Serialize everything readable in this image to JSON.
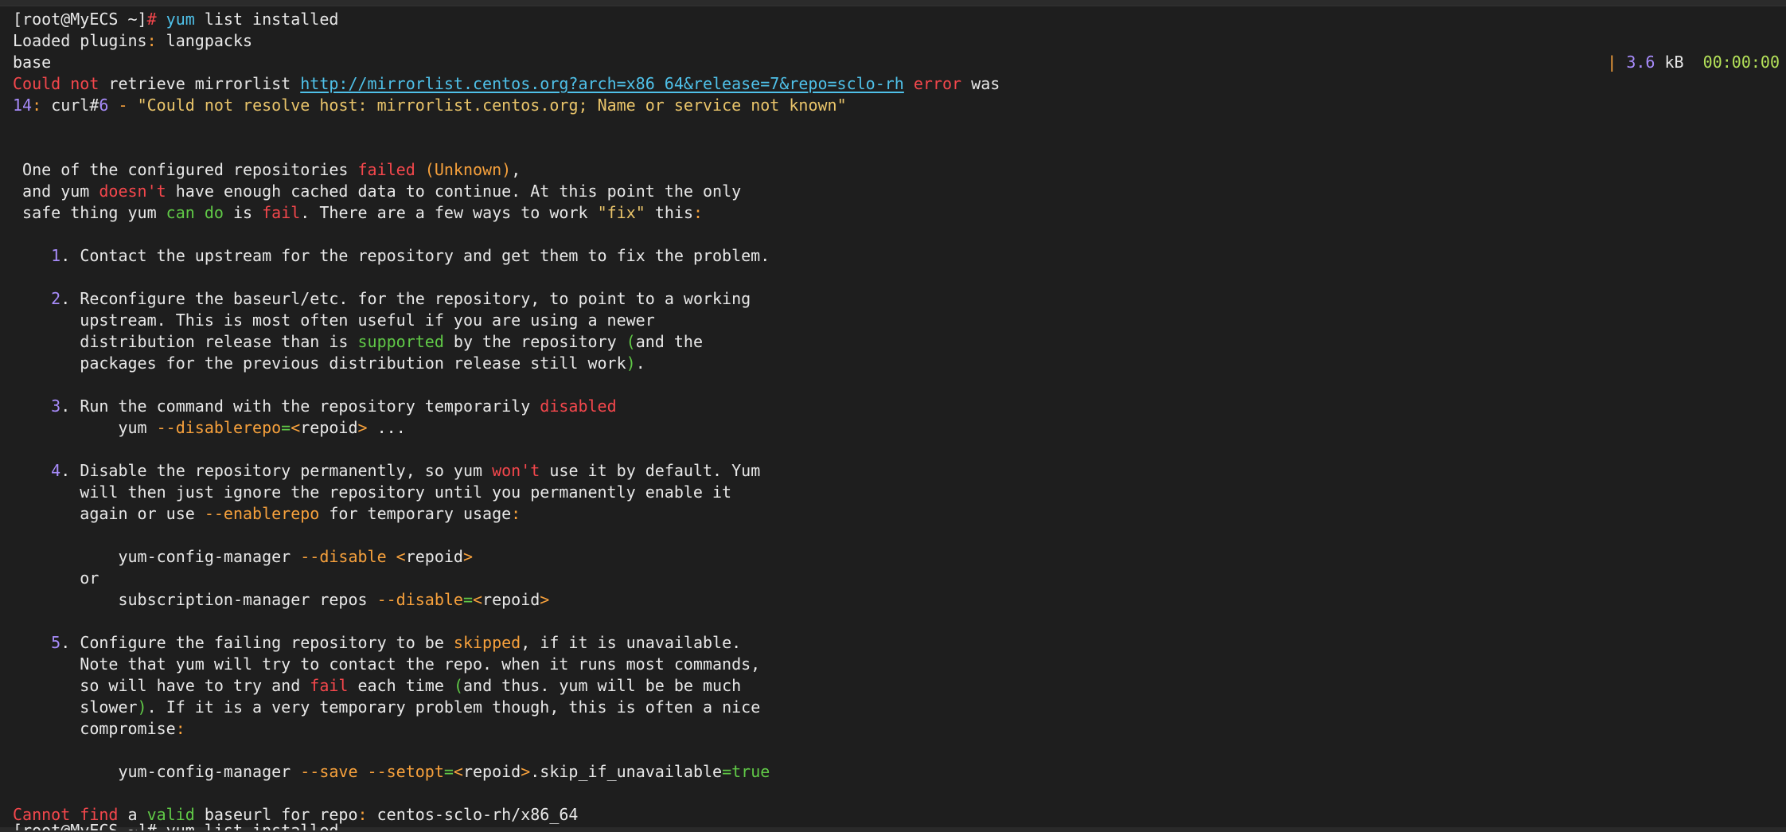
{
  "terminal": {
    "prompt": "[root@MyECS ~]",
    "prompt_symbol": "#",
    "command_main": "yum",
    "command_rest": "list installed",
    "loaded_plugins_label": "Loaded plugins",
    "loaded_plugins_value": "langpacks",
    "repo_base": "base",
    "repo_size_sep": "|",
    "repo_size_num": "3.6",
    "repo_size_unit": "kB",
    "repo_time": "00:00:00",
    "err1_a": "Could not",
    "err1_b": "retrieve mirrorlist",
    "err1_url": "http://mirrorlist.centos.org?arch=x86_64&release=7&repo=sclo-rh",
    "err1_c": "error",
    "err1_d": "was",
    "err2_num": "14",
    "err2_a": "curl#",
    "err2_num2": "6",
    "err2_b": "\"Could not resolve host: mirrorlist.centos.org; Name or service not known\"",
    "msg1_a": "One of the configured repositories",
    "msg1_failed": "failed",
    "msg1_unknown": "Unknown",
    "msg2_a": "and yum",
    "msg2_doesnt": "doesn't",
    "msg2_b": "have enough cached data to continue. At this point the only",
    "msg3_a": "safe thing yum",
    "msg3_can": "can do",
    "msg3_b": "is",
    "msg3_fail": "fail",
    "msg3_c": "There are a few ways to work",
    "msg3_fix": "\"fix\"",
    "msg3_d": "this",
    "item1_num": "1",
    "item1_text": "Contact the upstream for the repository and get them to fix the problem.",
    "item2_num": "2",
    "item2_l1": "Reconfigure the baseurl/etc. for the repository, to point to a working",
    "item2_l2": "upstream. This is most often useful if you are using a newer",
    "item2_l3a": "distribution release than is",
    "item2_l3_supported": "supported",
    "item2_l3b": "by the repository",
    "item2_l3c": "and the",
    "item2_l4": "packages for the previous distribution release still work",
    "item3_num": "3",
    "item3_text": "Run the command with the repository temporarily",
    "item3_disabled": "disabled",
    "item3_cmd_a": "yum",
    "item3_cmd_flag": "--disablerepo",
    "item3_cmd_repoid": "repoid",
    "item3_cmd_tail": "...",
    "item4_num": "4",
    "item4_l1a": "Disable the repository permanently, so yum",
    "item4_l1_wont": "won't",
    "item4_l1b": "use it by default. Yum",
    "item4_l2": "will then just ignore the repository until you permanently enable it",
    "item4_l3a": "again or use",
    "item4_l3_flag": "--enablerepo",
    "item4_l3b": "for temporary usage",
    "item4_cmd1_a": "yum-config-manager",
    "item4_cmd1_flag": "--disable",
    "item4_cmd1_repoid": "repoid",
    "item4_or": "or",
    "item4_cmd2_a": "subscription-manager repos",
    "item4_cmd2_flag": "--disable",
    "item4_cmd2_repoid": "repoid",
    "item5_num": "5",
    "item5_l1a": "Configure the failing repository to be",
    "item5_l1_skipped": "skipped",
    "item5_l1b": "if it is unavailable.",
    "item5_l2": "Note that yum will try to contact the repo. when it runs most commands,",
    "item5_l3a": "so will have to try and",
    "item5_l3_fail": "fail",
    "item5_l3b": "each time",
    "item5_l3c": "and thus. yum will be be much",
    "item5_l4a": "slower",
    "item5_l4b": "If it is a very temporary problem though, this is often a nice",
    "item5_l5": "compromise",
    "item5_cmd_a": "yum-config-manager",
    "item5_cmd_save": "--save",
    "item5_cmd_setopt": "--setopt",
    "item5_cmd_repoid": "repoid",
    "item5_cmd_opt": ".skip_if_unavailable",
    "item5_cmd_true": "true",
    "final_a": "Cannot find",
    "final_b": "a",
    "final_valid": "valid",
    "final_c": "baseurl for repo",
    "final_repo": "centos-sclo-rh/x86_64",
    "next_prompt_partial": "[root@MyECS ~]# yum list installed"
  }
}
